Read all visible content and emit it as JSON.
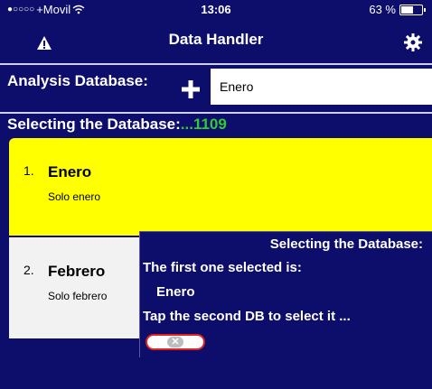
{
  "status_bar": {
    "signal_dots": "●○○○○",
    "carrier": "+Movil",
    "time": "13:06",
    "battery_percent_text": "63 %",
    "battery_level": 0.63
  },
  "nav": {
    "title": "Data Handler",
    "left_icon": "warning-triangle-icon",
    "right_icon": "gear-icon"
  },
  "analysis": {
    "label": "Analysis Database:",
    "add_icon": "plus-icon",
    "input_value": "Enero"
  },
  "selecting": {
    "label": "Selecting the Database:",
    "count": "...1109",
    "count_color": "#2ecc2e"
  },
  "databases": [
    {
      "number": "1.",
      "name": "Enero",
      "description": "Solo enero",
      "highlight_color": "#ffff00"
    },
    {
      "number": "2.",
      "name": "Febrero",
      "description": "Solo febrero"
    }
  ],
  "popup": {
    "title": "Selecting the Database:",
    "line1": "The first one selected is:",
    "selected_name": "Enero",
    "line3": "Tap the second DB to select it ...",
    "close_glyph": "✕"
  },
  "colors": {
    "background": "#0d0d6b",
    "accent_close_border": "#e0231c"
  }
}
